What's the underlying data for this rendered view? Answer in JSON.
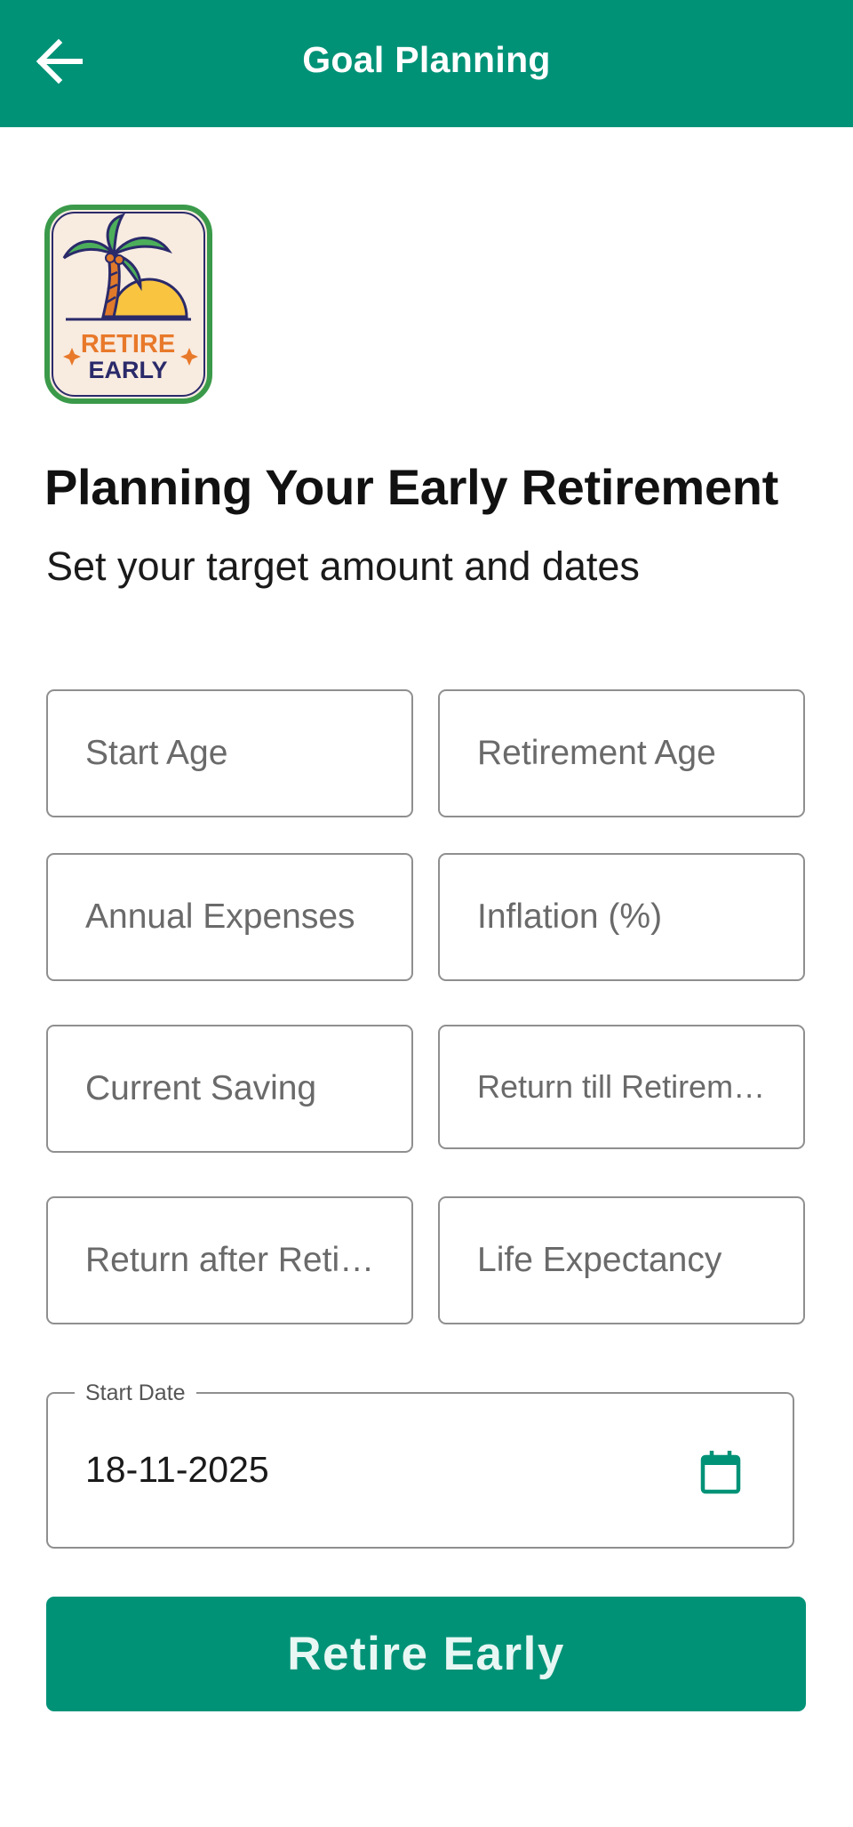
{
  "app_bar": {
    "title": "Goal Planning",
    "back_icon": "arrow-left-icon"
  },
  "logo": {
    "line1": "RETIRE",
    "line2": "EARLY"
  },
  "heading": "Planning Your Early Retirement",
  "subheading": "Set your target amount and dates",
  "fields": {
    "start_age": {
      "placeholder": "Start Age",
      "value": ""
    },
    "retirement_age": {
      "placeholder": "Retirement Age",
      "value": ""
    },
    "annual_expenses": {
      "placeholder": "Annual Expenses",
      "value": ""
    },
    "inflation": {
      "placeholder": "Inflation (%)",
      "value": ""
    },
    "current_saving": {
      "placeholder": "Current Saving",
      "value": ""
    },
    "return_till_retirement": {
      "placeholder": "Return till Retirem…",
      "value": ""
    },
    "return_after_retirement": {
      "placeholder": "Return after Reti…",
      "value": ""
    },
    "life_expectancy": {
      "placeholder": "Life Expectancy",
      "value": ""
    }
  },
  "start_date": {
    "label": "Start Date",
    "value": "18-11-2025",
    "icon": "calendar-icon"
  },
  "cta": {
    "label": "Retire Early"
  },
  "colors": {
    "primary": "#009277",
    "logo_border": "#3a9a4a",
    "logo_bg": "#f8ebe0"
  }
}
